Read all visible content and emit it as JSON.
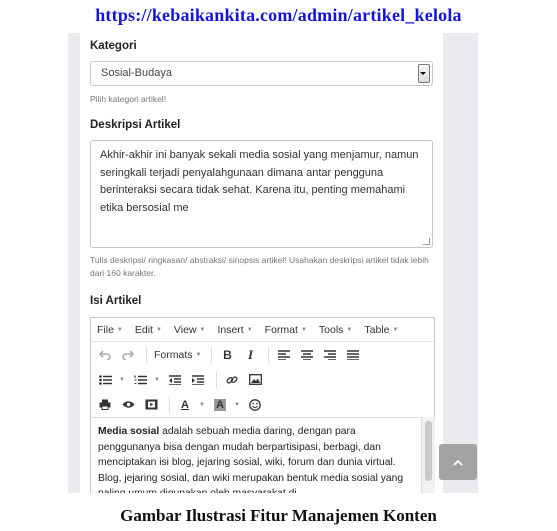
{
  "url": "https://kebaikankita.com/admin/artikel_kelola",
  "caption": "Gambar Ilustrasi Fitur Manajemen Konten",
  "form": {
    "kategori_label": "Kategori",
    "kategori_value": "Sosial-Budaya",
    "kategori_help": "Pilih kategori artikel!",
    "deskripsi_label": "Deskripsi Artikel",
    "deskripsi_value": "Akhir-akhir ini banyak sekali media sosial yang menjamur, namun seringkali terjadi penyalahgunaan dimana antar pengguna berinteraksi secara tidak sehat. Karena itu, penting memahami etika bersosial me",
    "deskripsi_help": "Tulis deskripsi/ ringkasan/ abstraksi/ sinopsis artikel! Usahakan deskripsi artikel tidak lebih dari 160 karakter.",
    "isi_label": "Isi Artikel"
  },
  "editor": {
    "menus": [
      "File",
      "Edit",
      "View",
      "Insert",
      "Format",
      "Tools",
      "Table"
    ],
    "formats_label": "Formats",
    "bold_label": "B",
    "italic_label": "I",
    "font_color_label": "A",
    "bg_color_label": "A",
    "content_bold": "Media sosial",
    "content_rest": " adalah sebuah media daring, dengan para penggunanya bisa dengan mudah berpartisipasi, berbagi, dan menciptakan isi blog, jejaring sosial, wiki, forum dan dunia virtual. Blog, jejaring sosial, dan wiki merupakan bentuk media sosial yang paling umum digunakan oleh masyarakat di"
  },
  "icons": {
    "undo": "undo-icon",
    "redo": "redo-icon",
    "align_left": "align-left-icon",
    "align_center": "align-center-icon",
    "align_right": "align-right-icon",
    "justify": "align-justify-icon",
    "bullet_list": "bullet-list-icon",
    "numbered_list": "numbered-list-icon",
    "outdent": "outdent-icon",
    "indent": "indent-icon",
    "link": "link-icon",
    "image": "image-icon",
    "print": "print-icon",
    "preview": "preview-eye-icon",
    "media": "media-icon",
    "emoticon": "emoticon-icon",
    "scroll_top": "chevron-up-icon"
  },
  "colors": {
    "url": "#1515d6",
    "scroll_button": "#a3a3a3",
    "side_gray": "#e9ebee"
  }
}
